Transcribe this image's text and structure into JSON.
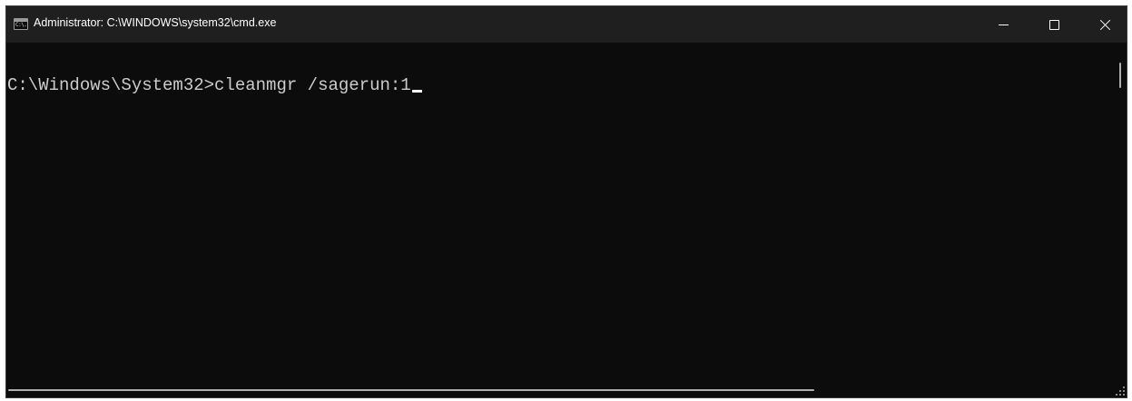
{
  "window": {
    "title": "Administrator: C:\\WINDOWS\\system32\\cmd.exe",
    "icon": "cmd-console-icon",
    "icon_glyph": "C:\\."
  },
  "controls": {
    "minimize_icon": "minimize-icon",
    "maximize_icon": "maximize-icon",
    "close_icon": "close-icon"
  },
  "console": {
    "prompt": "C:\\Windows\\System32>",
    "command": "cleanmgr /sagerun:1",
    "text_color": "#cccccc",
    "background_color": "#0c0c0c"
  }
}
